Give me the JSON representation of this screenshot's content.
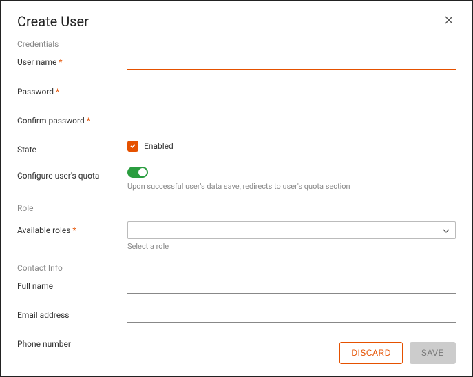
{
  "header": {
    "title": "Create User"
  },
  "sections": {
    "credentials": "Credentials",
    "role": "Role",
    "contact": "Contact Info"
  },
  "fields": {
    "username": {
      "label": "User name",
      "value": ""
    },
    "password": {
      "label": "Password",
      "value": ""
    },
    "confirm_password": {
      "label": "Confirm password",
      "value": ""
    },
    "state": {
      "label": "State",
      "checkbox_label": "Enabled",
      "checked": true
    },
    "quota": {
      "label": "Configure user's quota",
      "enabled": true,
      "helper": "Upon successful user's data save, redirects to user's quota section"
    },
    "roles": {
      "label": "Available roles",
      "placeholder": "",
      "helper": "Select a role"
    },
    "fullname": {
      "label": "Full name",
      "value": ""
    },
    "email": {
      "label": "Email address",
      "value": ""
    },
    "phone": {
      "label": "Phone number",
      "value": ""
    }
  },
  "footer": {
    "discard": "DISCARD",
    "save": "SAVE"
  }
}
